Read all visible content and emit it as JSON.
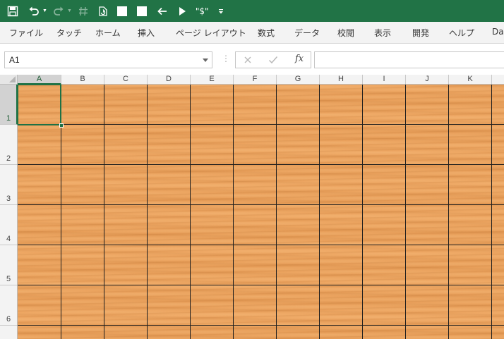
{
  "quick_access": {
    "save": "save-icon",
    "undo": "undo-icon",
    "redo": "redo-icon",
    "hash": "hash-icon",
    "refresh": "refresh-icon",
    "square1": "square-icon",
    "square2": "square-icon",
    "back": "arrow-left-icon",
    "play": "play-icon",
    "format_label": "\"$\"",
    "customize": "customize-icon"
  },
  "ribbon": {
    "tabs": [
      "ファイル",
      "タッチ",
      "ホーム",
      "挿入",
      "ページ レイアウト",
      "数式",
      "データ",
      "校閲",
      "表示",
      "開発",
      "ヘルプ",
      "Da"
    ]
  },
  "formula_bar": {
    "name_box": "A1",
    "separator": "⋮",
    "fx_label": "fx",
    "formula": ""
  },
  "sheet": {
    "columns": [
      "A",
      "B",
      "C",
      "D",
      "E",
      "F",
      "G",
      "H",
      "I",
      "J",
      "K"
    ],
    "rows": [
      "1",
      "2",
      "3",
      "4",
      "5",
      "6"
    ],
    "selected_cell": "A1",
    "background": "wood-texture",
    "colors": {
      "accent": "#217346",
      "wood": "#eca35e",
      "gridline": "#1e1e1e"
    }
  }
}
